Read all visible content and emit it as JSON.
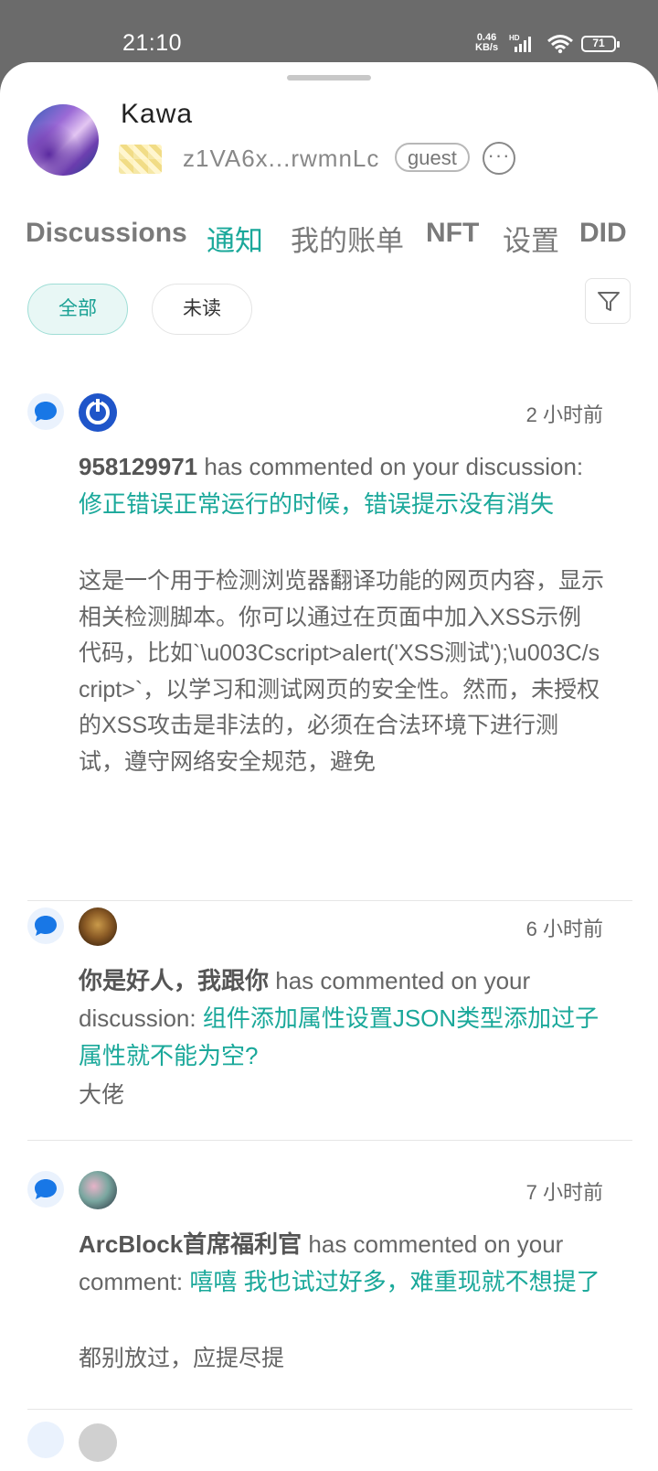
{
  "status_bar": {
    "time": "21:10",
    "speed_value": "0.46",
    "speed_unit": "KB/s",
    "hd": "HD",
    "battery": "71"
  },
  "profile": {
    "name": "Kawa",
    "did": "z1VA6x...rwmnLc",
    "role": "guest",
    "more_icon": "ellipsis-icon"
  },
  "tabs": [
    {
      "label": "Discussions",
      "active": false
    },
    {
      "label": "通知",
      "active": true
    },
    {
      "label": "我的账单",
      "active": false
    },
    {
      "label": "NFT",
      "active": false
    },
    {
      "label": "设置",
      "active": false
    },
    {
      "label": "DID",
      "active": false
    }
  ],
  "filters": {
    "all": "全部",
    "unread": "未读",
    "filter_icon": "funnel-icon"
  },
  "accent_color": "#1aa89a",
  "notifications": [
    {
      "time": "2 小时前",
      "user": "958129971",
      "action": " has commented on your discussion: ",
      "target": "修正错误正常运行的时候，错误提示没有消失",
      "body": "这是一个用于检测浏览器翻译功能的网页内容，显示相关检测脚本。你可以通过在页面中加入XSS示例代码，比如`\\u003Cscript>alert('XSS测试');\\u003C/script>`，以学习和测试网页的安全性。然而，未授权的XSS攻击是非法的，必须在合法环境下进行测试，遵守网络安全规范，避免"
    },
    {
      "time": "6 小时前",
      "user": "你是好人，我跟你",
      "action": " has commented on your discussion: ",
      "target": "组件添加属性设置JSON类型添加过子属性就不能为空?",
      "body": "大佬"
    },
    {
      "time": "7 小时前",
      "user": "ArcBlock首席福利官",
      "action": " has commented on your comment: ",
      "target": "嘻嘻 我也试过好多，难重现就不想提了",
      "body": "都别放过，应提尽提"
    }
  ]
}
